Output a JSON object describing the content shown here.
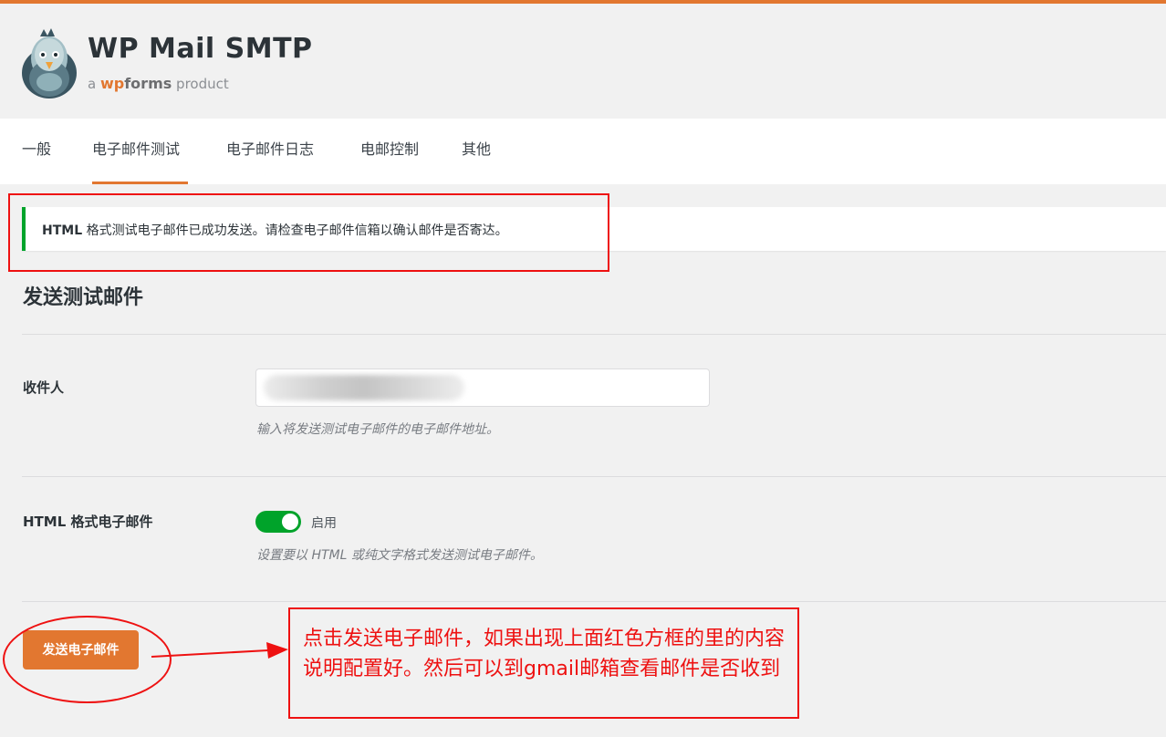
{
  "brand": {
    "title": "WP Mail SMTP",
    "sub_prefix": "a",
    "sub_wp": "wp",
    "sub_forms": "forms",
    "sub_suffix": "product",
    "accent": "#e27730"
  },
  "tabs": [
    {
      "label": "一般",
      "active": false
    },
    {
      "label": "电子邮件测试",
      "active": true
    },
    {
      "label": "电子邮件日志",
      "active": false
    },
    {
      "label": "电邮控制",
      "active": false
    },
    {
      "label": "其他",
      "active": false
    }
  ],
  "notice": {
    "bold": "HTML",
    "text": " 格式测试电子邮件已成功发送。请检查电子邮件信箱以确认邮件是否寄达。",
    "color": "#00a32a"
  },
  "section_title": "发送测试邮件",
  "recipient": {
    "label": "收件人",
    "help": "输入将发送测试电子邮件的电子邮件地址。"
  },
  "html_format": {
    "label": "HTML 格式电子邮件",
    "toggle_on": true,
    "toggle_label": "启用",
    "help": "设置要以 HTML 或纯文字格式发送测试电子邮件。",
    "toggle_color": "#00a32a"
  },
  "send_button": "发送电子邮件",
  "annotation": {
    "note": "点击发送电子邮件，如果出现上面红色方框的里的内容说明配置好。然后可以到gmail邮箱查看邮件是否收到",
    "color": "#ee1111"
  }
}
